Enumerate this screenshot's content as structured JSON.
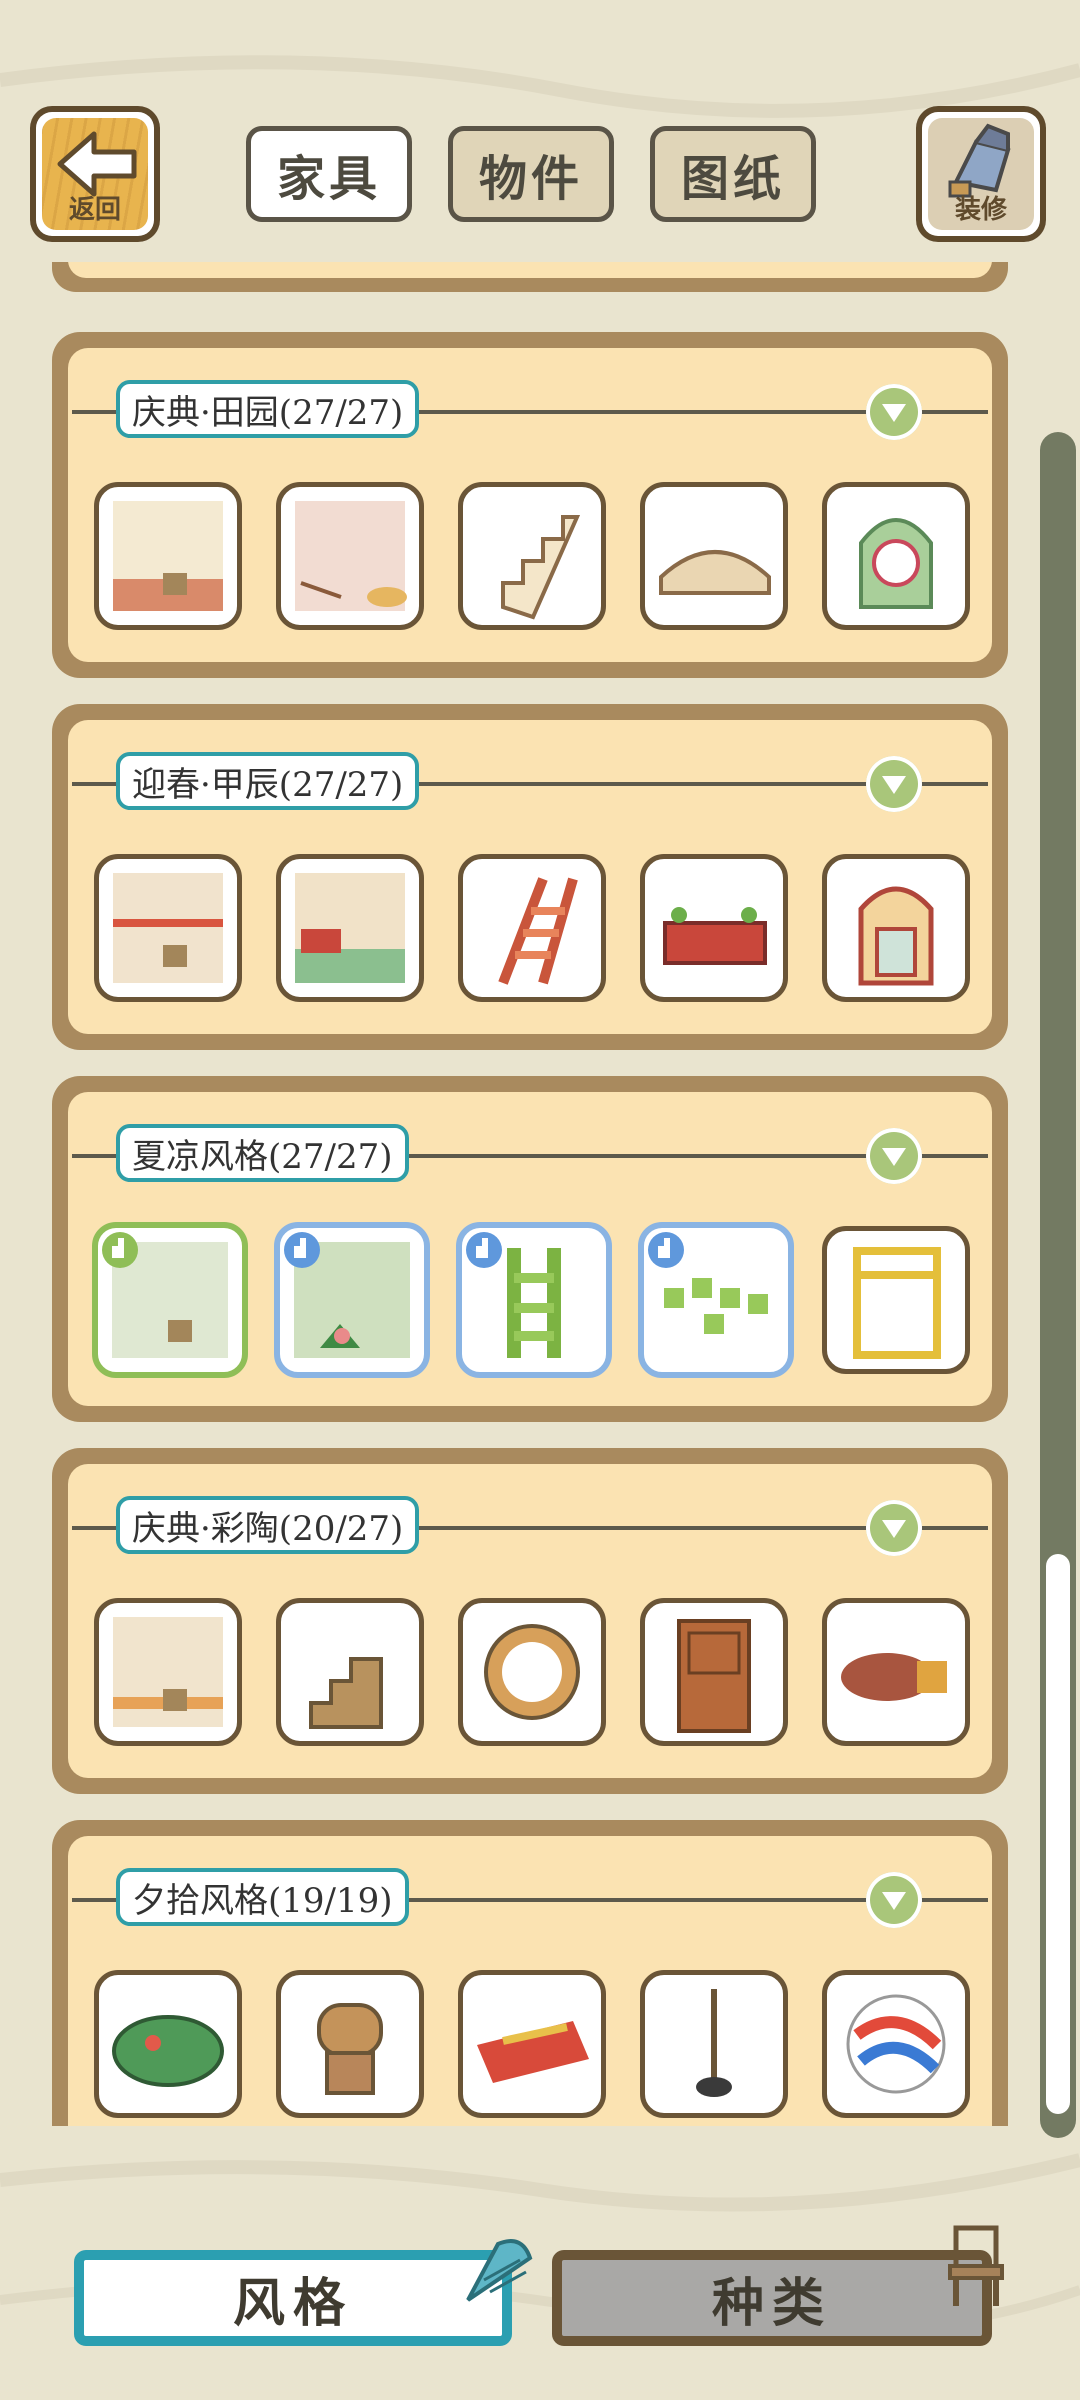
{
  "header": {
    "back_label": "返回",
    "decorate_label": "装修",
    "tabs": [
      {
        "label": "家具",
        "active": true
      },
      {
        "label": "物件",
        "active": false
      },
      {
        "label": "图纸",
        "active": false
      }
    ]
  },
  "sets": [
    {
      "title": "庆典·田园(27/27)",
      "items": [
        "wallpaper-wooden-basket",
        "floor-pink-bowl",
        "wooden-stairs",
        "wooden-bench",
        "green-arched-window"
      ]
    },
    {
      "title": "迎春·甲辰(27/27)",
      "items": [
        "wallpaper-red-trim",
        "floor-green-tile-fence",
        "red-ladder",
        "red-festive-bench",
        "festive-arched-window"
      ]
    },
    {
      "title": "夏凉风格(27/27)",
      "items": [
        "bamboo-wallpaper",
        "green-floor-plant",
        "bamboo-ladder",
        "bamboo-stools",
        "bamboo-window"
      ]
    },
    {
      "title": "庆典·彩陶(20/27)",
      "items": [
        "wallpaper-pottery",
        "clay-stairs",
        "round-clay-window",
        "wooden-door",
        "pottery-pillow"
      ]
    },
    {
      "title": "夕拾风格(19/19)",
      "items": [
        "green-frog-stone",
        "clay-frog-statue",
        "woven-rug",
        "standing-pole",
        "colorful-marble"
      ]
    }
  ],
  "bottom": {
    "style_label": "风格",
    "kind_label": "种类"
  },
  "colors": {
    "background": "#e9e4cf",
    "panel_frame": "#a98a5e",
    "panel_cream": "#fbe3b2",
    "title_border": "#2f9ea7",
    "dropdown_green": "#a9c67a",
    "style_accent": "#2b9fb1"
  }
}
